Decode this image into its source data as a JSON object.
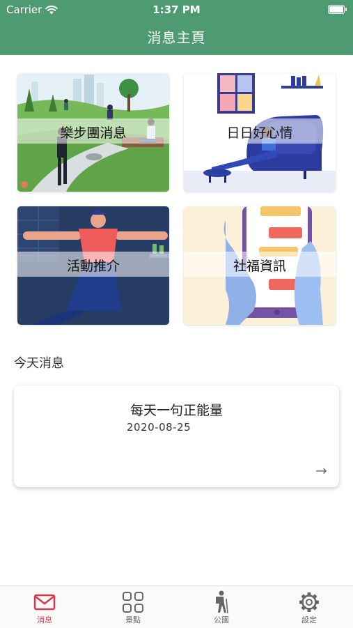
{
  "status_bar": {
    "carrier": "Carrier",
    "time": "1:37 PM"
  },
  "header": {
    "title": "消息主頁"
  },
  "cards": [
    {
      "label": "樂步團消息"
    },
    {
      "label": "日日好心情"
    },
    {
      "label": "活動推介"
    },
    {
      "label": "社福資訊"
    }
  ],
  "today": {
    "section_title": "今天消息",
    "news": {
      "title": "每天一句正能量",
      "date": "2020-08-25",
      "arrow": "→"
    }
  },
  "tabbar": {
    "active_color": "#d93949",
    "items": [
      {
        "label": "消息",
        "icon": "mail-icon"
      },
      {
        "label": "景點",
        "icon": "grid-icon"
      },
      {
        "label": "公園",
        "icon": "hiker-icon"
      },
      {
        "label": "設定",
        "icon": "gear-icon"
      }
    ]
  },
  "colors": {
    "header": "#4e9a72"
  }
}
